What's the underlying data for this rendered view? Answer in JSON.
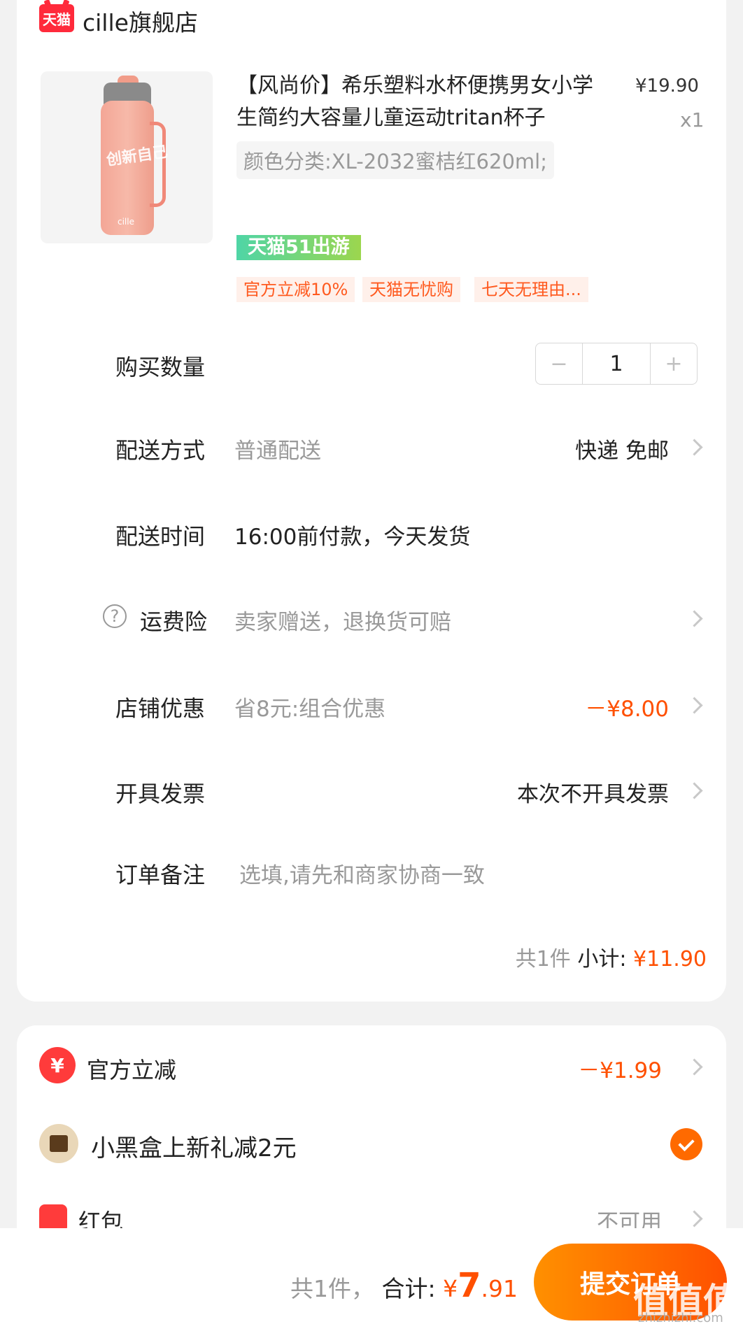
{
  "shop": {
    "logo_text": "天猫",
    "name": "cille旗舰店"
  },
  "product": {
    "image_text": "创新自己",
    "image_brand": "cille",
    "title": "【风尚价】希乐塑料水杯便携男女小学生简约大容量儿童运动tritan杯子",
    "price": "¥19.90",
    "qty": "x1",
    "variant": "颜色分类:XL-2032蜜桔红620ml;",
    "promo_badge": "天猫51出游",
    "tags": [
      "官方立减10%",
      "天猫无忧购",
      "七天无理由..."
    ]
  },
  "rows": {
    "quantity": {
      "label": "购买数量",
      "minus": "−",
      "value": "1",
      "plus": "+"
    },
    "shipping": {
      "label": "配送方式",
      "value": "普通配送",
      "right": "快递 免邮"
    },
    "ship_time": {
      "label": "配送时间",
      "value": "16:00前付款，今天发货"
    },
    "insurance": {
      "icon": "?",
      "label": "运费险",
      "value": "卖家赠送，退换货可赔"
    },
    "shop_discount": {
      "label": "店铺优惠",
      "value": "省8元:组合优惠",
      "right": "－¥8.00"
    },
    "invoice": {
      "label": "开具发票",
      "right": "本次不开具发票"
    },
    "note": {
      "label": "订单备注",
      "placeholder": "选填,请先和商家协商一致"
    }
  },
  "subtotal": {
    "count": "共1件",
    "label": "小计:",
    "amount": "¥11.90"
  },
  "discounts": {
    "official": {
      "label": "官方立减",
      "right": "－¥1.99"
    },
    "blackbox": {
      "label": "小黑盒上新礼减2元"
    },
    "redpacket": {
      "label": "红包",
      "right": "不可用"
    }
  },
  "bottom": {
    "count": "共1件，",
    "label": "合计:",
    "currency": "¥",
    "amount_int": "7",
    "amount_dec": ".91",
    "submit": "提交订单"
  },
  "watermark": {
    "text": "值值值",
    "url": "zhizhizhi.com"
  },
  "colors": {
    "accent": "#ff5000",
    "tmall_red": "#ff2a3b"
  }
}
